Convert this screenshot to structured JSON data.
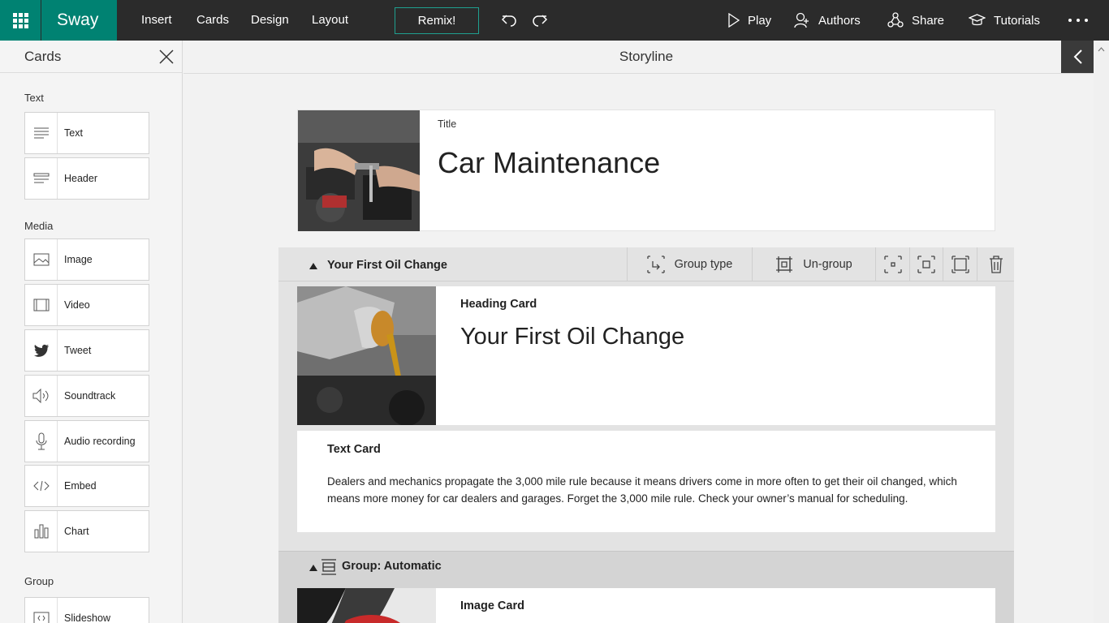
{
  "app": {
    "name": "Sway"
  },
  "menu": {
    "insert": "Insert",
    "cards": "Cards",
    "design": "Design",
    "layout": "Layout",
    "remix": "Remix!"
  },
  "toolbar": {
    "play": "Play",
    "authors": "Authors",
    "share": "Share",
    "tutorials": "Tutorials"
  },
  "cards_panel": {
    "title": "Cards",
    "sections": {
      "text": "Text",
      "media": "Media",
      "group": "Group"
    },
    "text_items": [
      "Text",
      "Header"
    ],
    "media_items": [
      "Image",
      "Video",
      "Tweet",
      "Soundtrack",
      "Audio recording",
      "Embed",
      "Chart"
    ],
    "group_items": [
      "Slideshow"
    ]
  },
  "storyline": {
    "title": "Storyline",
    "title_card": {
      "kind": "Title",
      "text": "Car Maintenance"
    },
    "group1": {
      "name": "Your First Oil Change",
      "group_type": "Group type",
      "ungroup": "Un-group",
      "heading_card": {
        "kind": "Heading Card",
        "text": "Your First Oil Change"
      },
      "text_card": {
        "kind": "Text Card",
        "body": "Dealers and mechanics propagate the 3,000 mile rule because it means drivers come in more often to get their oil changed, which means more money for car dealers and garages. Forget the 3,000 mile rule. Check your owner’s manual for scheduling."
      }
    },
    "group2": {
      "name": "Group: Automatic",
      "image_card": {
        "kind": "Image Card"
      }
    }
  },
  "colors": {
    "accent": "#008272",
    "topbar": "#2b2b2b"
  }
}
